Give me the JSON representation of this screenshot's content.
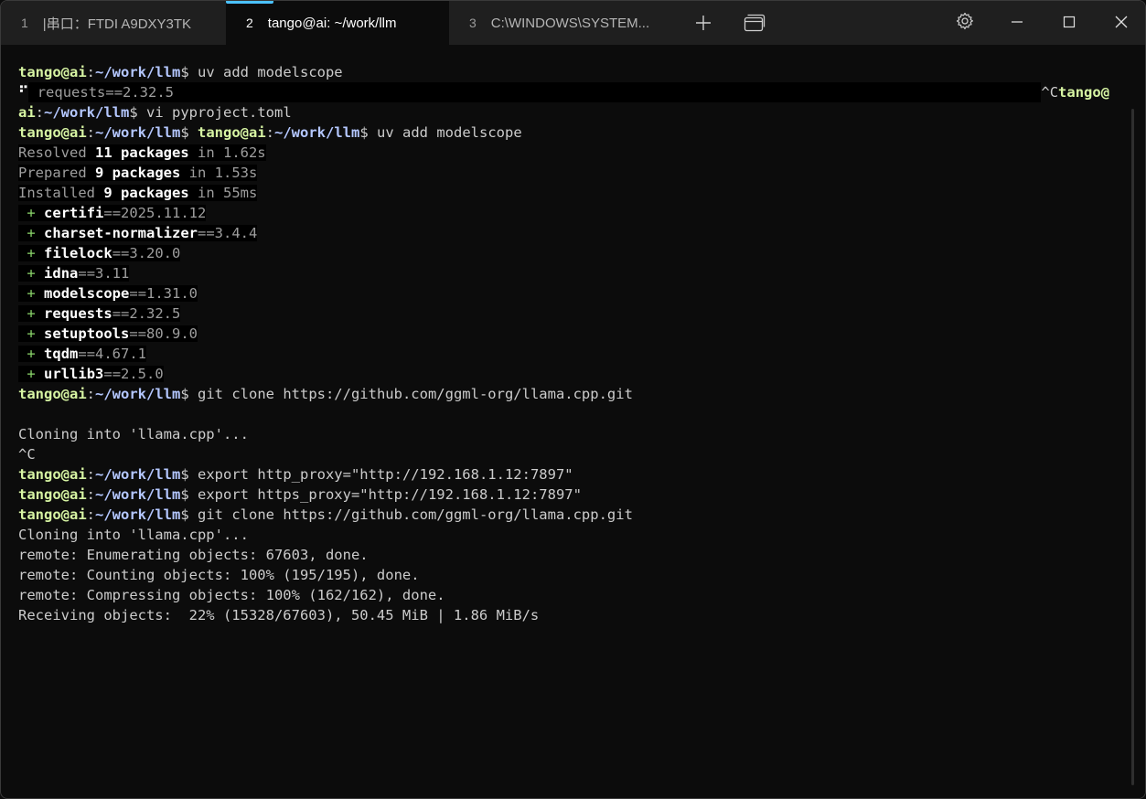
{
  "tabs": [
    {
      "num": "1",
      "title": "|串口：FTDI A9DXY3TK"
    },
    {
      "num": "2",
      "title": "tango@ai: ~/work/llm"
    },
    {
      "num": "3",
      "title": "C:\\WINDOWS\\SYSTEM..."
    }
  ],
  "icons": {
    "new_tab": "plus-icon",
    "tab_dropdown": "dropdown-icon",
    "settings": "gear-icon",
    "minimize": "minimize-icon",
    "maximize": "maximize-icon",
    "close": "close-icon"
  },
  "prompt": {
    "user": "tango@ai",
    "colon": ":",
    "path": "~/work/llm",
    "dollar": "$"
  },
  "lines": {
    "l1_cmd": " uv add modelscope",
    "l2_spinner": "⠋",
    "l2_text": "requests==2.32.5",
    "l2_ctrl": "^C",
    "l2_user": "tango@",
    "l3_user_rest": "ai",
    "l3_cmd": " vi pyproject.toml",
    "l4_cmd": " uv add modelscope",
    "resolved": {
      "pre": "Resolved ",
      "bold": "11 packages",
      "post": " in 1.62s"
    },
    "prepared": {
      "pre": "Prepared ",
      "bold": "9 packages",
      "post": " in 1.53s"
    },
    "installed": {
      "pre": "Installed ",
      "bold": "9 packages",
      "post": " in 55ms"
    },
    "packages": [
      {
        "name": "certifi",
        "ver": "==2025.11.12"
      },
      {
        "name": "charset-normalizer",
        "ver": "==3.4.4"
      },
      {
        "name": "filelock",
        "ver": "==3.20.0"
      },
      {
        "name": "idna",
        "ver": "==3.11"
      },
      {
        "name": "modelscope",
        "ver": "==1.31.0"
      },
      {
        "name": "requests",
        "ver": "==2.32.5"
      },
      {
        "name": "setuptools",
        "ver": "==80.9.0"
      },
      {
        "name": "tqdm",
        "ver": "==4.67.1"
      },
      {
        "name": "urllib3",
        "ver": "==2.5.0"
      }
    ],
    "plus": "+",
    "git1_cmd": " git clone https://github.com/ggml-org/llama.cpp.git",
    "cloning1": "Cloning into 'llama.cpp'...",
    "ctrl_c": "^C",
    "export1_cmd": " export http_proxy=\"http://192.168.1.12:7897\"",
    "export2_cmd": " export https_proxy=\"http://192.168.1.12:7897\"",
    "git2_cmd": " git clone https://github.com/ggml-org/llama.cpp.git",
    "cloning2": "Cloning into 'llama.cpp'...",
    "remote1": "remote: Enumerating objects: 67603, done.",
    "remote2": "remote: Counting objects: 100% (195/195), done.",
    "remote3": "remote: Compressing objects: 100% (162/162), done.",
    "receiving": "Receiving objects:  22% (15328/67603), 50.45 MiB | 1.86 MiB/s"
  }
}
